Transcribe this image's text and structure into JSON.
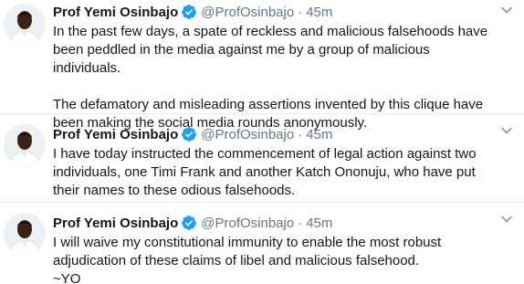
{
  "tweets": [
    {
      "author": {
        "name": "Prof Yemi Osinbajo",
        "handle": "@ProfOsinbajo",
        "verified": true
      },
      "separator": "·",
      "time": "45m",
      "paragraphs": [
        "In the past few days, a spate of reckless and malicious falsehoods have been peddled in the media against me by a group of malicious individuals.",
        "The defamatory and misleading assertions invented by this clique have been making the social media rounds anonymously."
      ]
    },
    {
      "author": {
        "name": "Prof Yemi Osinbajo",
        "handle": "@ProfOsinbajo",
        "verified": true
      },
      "separator": "·",
      "time": "45m",
      "paragraphs": [
        "I have today instructed the commencement of legal action against two individuals, one Timi Frank and another Katch Ononuju, who have put their names to these odious falsehoods."
      ]
    },
    {
      "author": {
        "name": "Prof Yemi Osinbajo",
        "handle": "@ProfOsinbajo",
        "verified": true
      },
      "separator": "·",
      "time": "45m",
      "paragraphs": [
        "I will waive my constitutional immunity to enable the most robust adjudication of these claims of libel and malicious falsehood.",
        "~YO"
      ]
    }
  ],
  "icons": {
    "verified": "verified-badge-icon",
    "menu": "chevron-down-icon",
    "avatar": "profile-photo"
  },
  "colors": {
    "verified": "#1da1f2",
    "secondary_text": "#657786",
    "primary_text": "#14171a",
    "divider": "#e6ecf0"
  }
}
